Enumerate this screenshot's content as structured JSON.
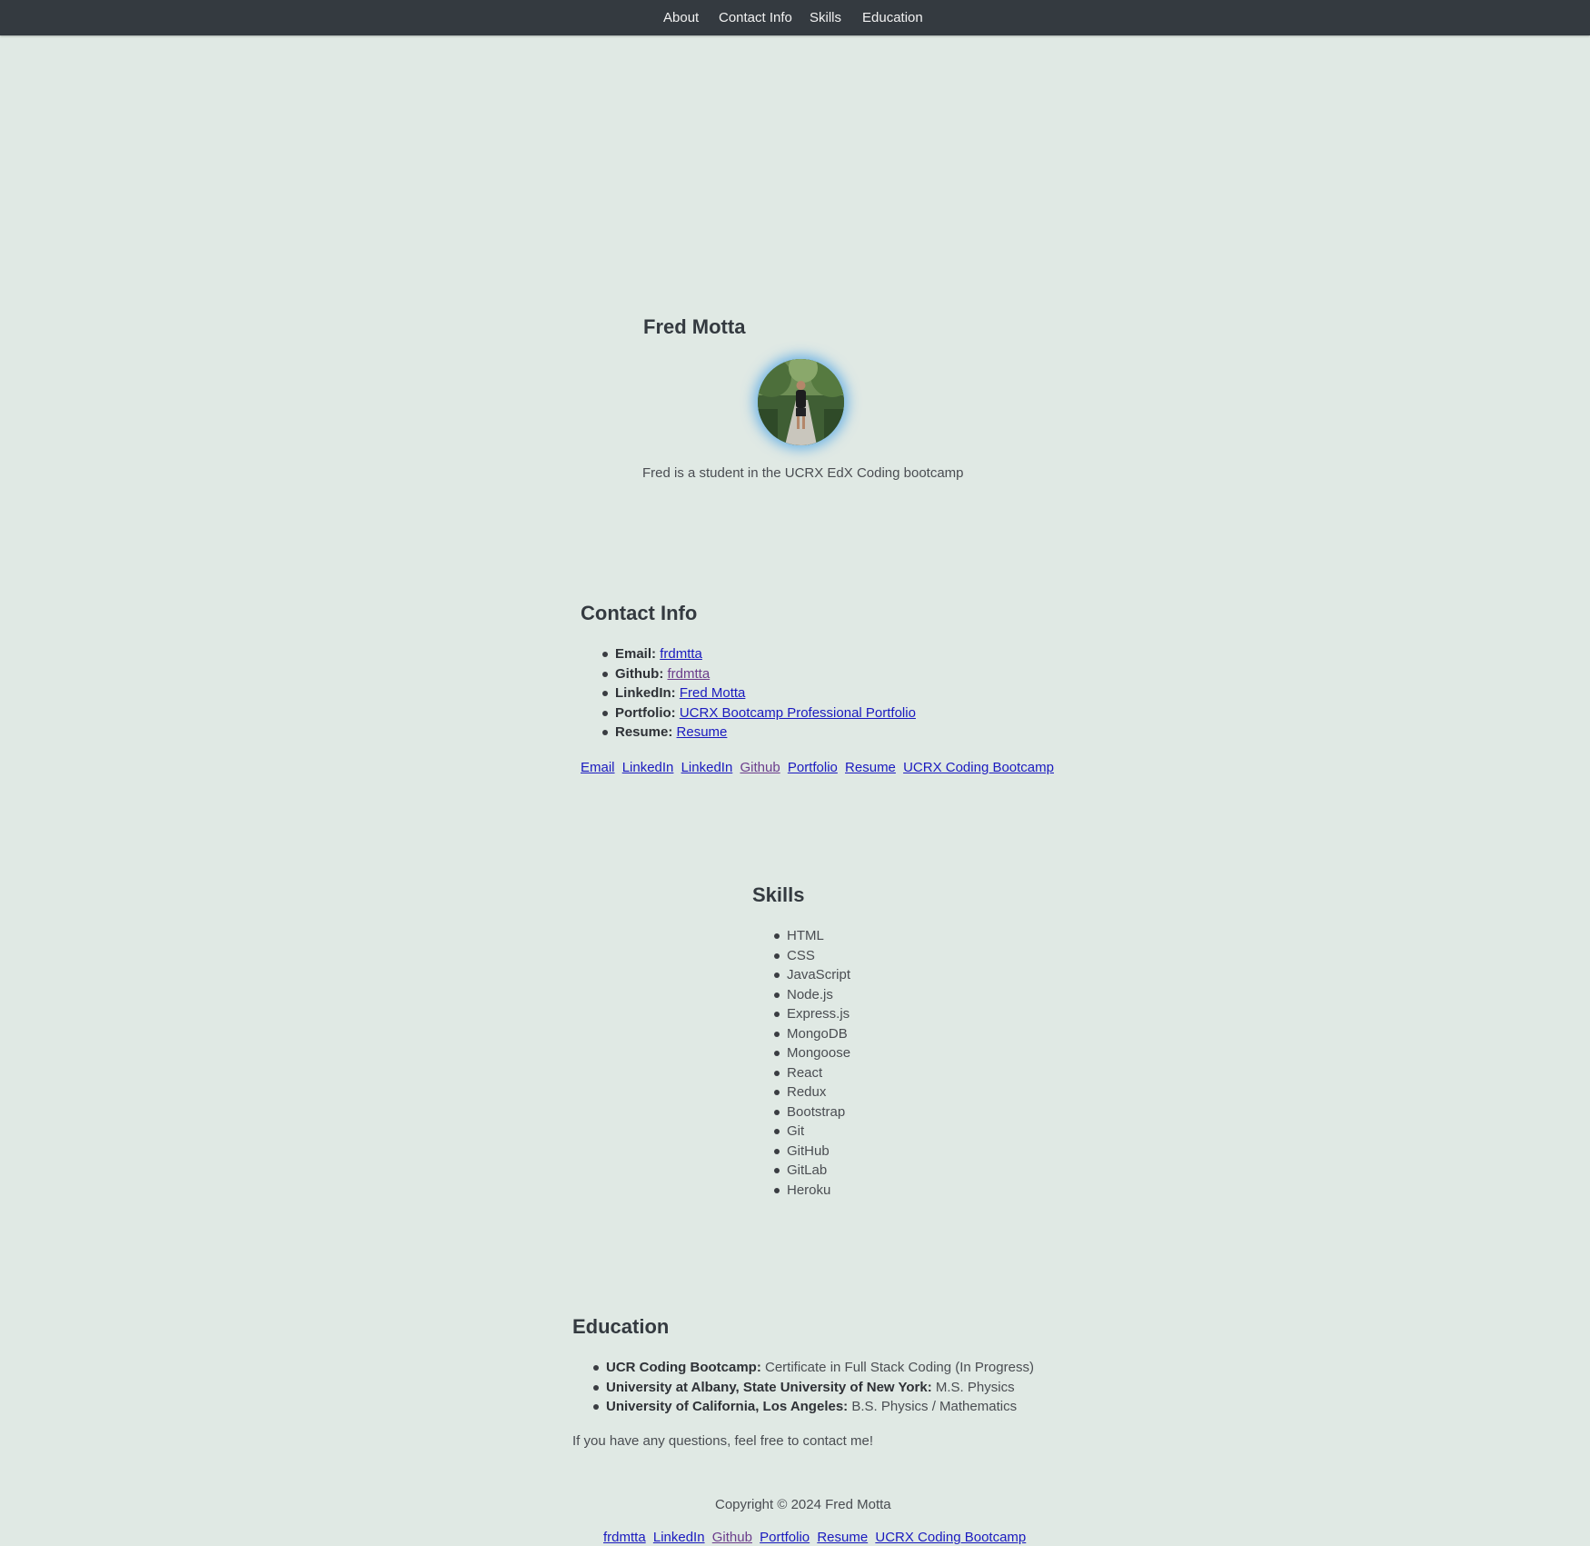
{
  "nav": {
    "about": "About",
    "contact": "Contact Info",
    "skills": "Skills",
    "education": "Education"
  },
  "about": {
    "name": "Fred Motta",
    "avatar_icon": "profile-photo",
    "bio": "Fred is a student in the UCRX EdX Coding bootcamp"
  },
  "contact": {
    "title": "Contact Info",
    "items": [
      {
        "label": "Email:",
        "link": "frdmtta"
      },
      {
        "label": "Github:",
        "link": "frdmtta"
      },
      {
        "label": "LinkedIn:",
        "link": "Fred Motta"
      },
      {
        "label": "Portfolio:",
        "link": "UCRX Bootcamp Professional Portfolio"
      },
      {
        "label": "Resume:",
        "link": "Resume"
      }
    ],
    "link_row": [
      "Email",
      "LinkedIn",
      "LinkedIn",
      "Github",
      "Portfolio",
      "Resume",
      "UCRX Coding Bootcamp"
    ]
  },
  "skills": {
    "title": "Skills",
    "items": [
      "HTML",
      "CSS",
      "JavaScript",
      "Node.js",
      "Express.js",
      "MongoDB",
      "Mongoose",
      "React",
      "Redux",
      "Bootstrap",
      "Git",
      "GitHub",
      "GitLab",
      "Heroku"
    ]
  },
  "education": {
    "title": "Education",
    "items": [
      {
        "school": "UCR Coding Bootcamp:",
        "degree": "Certificate in Full Stack Coding (In Progress)"
      },
      {
        "school": "University at Albany, State University of New York:",
        "degree": "M.S. Physics"
      },
      {
        "school": "University of California, Los Angeles:",
        "degree": "B.S. Physics / Mathematics"
      }
    ],
    "closing": "If you have any questions, feel free to contact me!"
  },
  "footer": {
    "copyright": "Copyright © 2024 Fred Motta",
    "links": [
      "frdmtta",
      "LinkedIn",
      "Github",
      "Portfolio",
      "Resume",
      "UCRX Coding Bootcamp"
    ]
  },
  "colors": {
    "background": "#e0e9e4",
    "navbar": "#343a40",
    "link": "#1a1abf",
    "visited_link": "#6b3d8c",
    "avatar_glow": "#46a0e6"
  }
}
